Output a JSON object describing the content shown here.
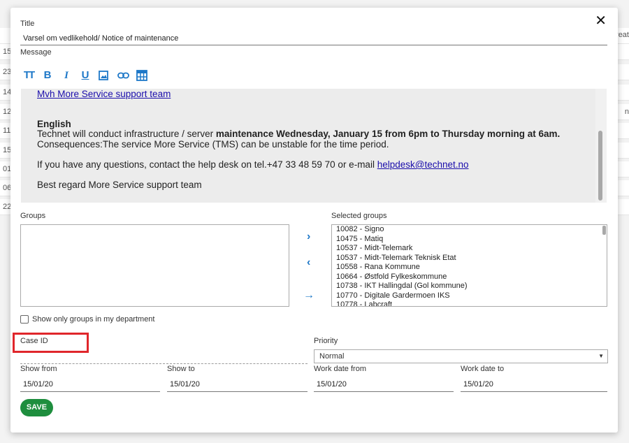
{
  "background": {
    "rows": [
      "15",
      "23",
      "14",
      "12",
      "11",
      "15",
      "01",
      "06",
      "22"
    ],
    "header_right": "reat",
    "row_right": "n"
  },
  "dialog": {
    "close_label": "✕",
    "title_label": "Title",
    "title_value": "Varsel om vedlikehold/ Notice of maintenance",
    "message_label": "Message",
    "toolbar": {
      "heading": "TT",
      "bold": "B",
      "italic": "I",
      "underline": "U"
    },
    "editor": {
      "signature_link": "Mvh More Service support team",
      "heading": "English",
      "line1_pre": "Technet will conduct infrastructure / server ",
      "line1_bold": "maintenance Wednesday, January 15 from 6pm to Thursday morning at 6am.",
      "line2": "Consequences:The service More Service (TMS) can be unstable for the time period.",
      "line3_pre": "If you have any questions, contact the help desk on tel.+47 33 48 59 70 or e-mail ",
      "line3_link": "helpdesk@technet.no",
      "line4": "Best regard More Service support team"
    },
    "groups_label": "Groups",
    "selected_groups_label": "Selected groups",
    "selected_groups": [
      "10082 - Signo",
      "10475 - Matiq",
      "10537 - Midt-Telemark",
      "10537 - Midt-Telemark Teknisk Etat",
      "10558 - Rana Kommune",
      "10664 - Østfold Fylkeskommune",
      "10738 - IKT Hallingdal (Gol kommune)",
      "10770 - Digitale Gardermoen IKS",
      "10778 - Labcraft"
    ],
    "arrows": {
      "add": "›",
      "remove": "‹",
      "add_all": "→"
    },
    "show_only_groups": "Show only groups in my department",
    "case_id_label": "Case ID",
    "priority_label": "Priority",
    "priority_value": "Normal",
    "show_from_label": "Show from",
    "show_from_value": "15/01/20",
    "show_to_label": "Show to",
    "show_to_value": "15/01/20",
    "work_from_label": "Work date from",
    "work_from_value": "15/01/20",
    "work_to_label": "Work date to",
    "work_to_value": "15/01/20",
    "save_label": "SAVE"
  },
  "colors": {
    "accent": "#1e78c8",
    "save": "#1e8e3e",
    "highlight": "#e0262b"
  }
}
